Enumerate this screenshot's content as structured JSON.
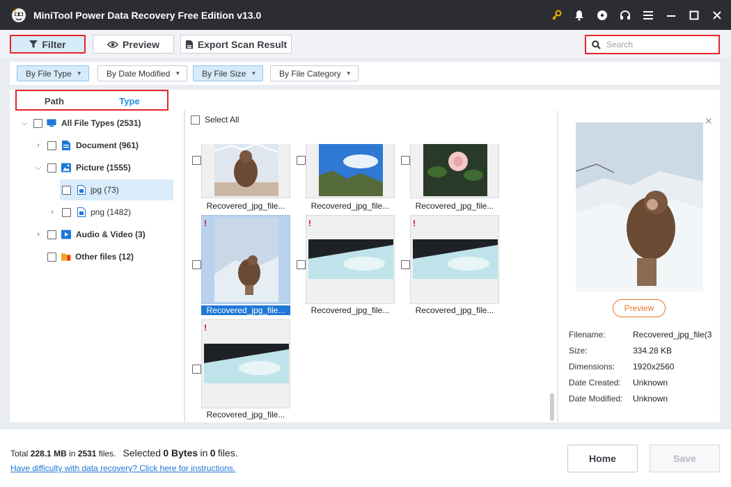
{
  "titlebar": {
    "title": "MiniTool Power Data Recovery Free Edition v13.0"
  },
  "toolbar": {
    "filter_label": "Filter",
    "preview_label": "Preview",
    "export_label": "Export Scan Result",
    "search_placeholder": "Search"
  },
  "filters": {
    "by_file_type": "By File Type",
    "by_date_modified": "By Date Modified",
    "by_file_size": "By File Size",
    "by_file_category": "By File Category"
  },
  "tabs": {
    "path": "Path",
    "type": "Type"
  },
  "tree": {
    "all": "All File Types (2531)",
    "document": "Document (961)",
    "picture": "Picture (1555)",
    "jpg": "jpg (73)",
    "png": "png (1482)",
    "audio_video": "Audio & Video (3)",
    "other": "Other files (12)"
  },
  "grid": {
    "select_all": "Select All",
    "items": [
      {
        "name": "Recovered_jpg_file...",
        "warn": ""
      },
      {
        "name": "Recovered_jpg_file...",
        "warn": ""
      },
      {
        "name": "Recovered_jpg_file...",
        "warn": ""
      },
      {
        "name": "Recovered_jpg_file...",
        "warn": "!"
      },
      {
        "name": "Recovered_jpg_file...",
        "warn": "!"
      },
      {
        "name": "Recovered_jpg_file...",
        "warn": "!"
      },
      {
        "name": "Recovered_jpg_file...",
        "warn": "!"
      }
    ]
  },
  "preview_panel": {
    "preview_button": "Preview",
    "filename_label": "Filename:",
    "filename_value": "Recovered_jpg_file(3",
    "size_label": "Size:",
    "size_value": "334.28 KB",
    "dimensions_label": "Dimensions:",
    "dimensions_value": "1920x2560",
    "created_label": "Date Created:",
    "created_value": "Unknown",
    "modified_label": "Date Modified:",
    "modified_value": "Unknown"
  },
  "footer": {
    "total_prefix": "Total",
    "total_size": "228.1 MB",
    "in_1": "in",
    "total_files": "2531",
    "files_sel": "files.",
    "selected_prefix": "Selected",
    "selected_size": "0 Bytes",
    "in_2": "in",
    "selected_files": "0",
    "files_end": "files.",
    "help_link": "Have difficulty with data recovery? Click here for instructions.",
    "home_label": "Home",
    "save_label": "Save"
  }
}
